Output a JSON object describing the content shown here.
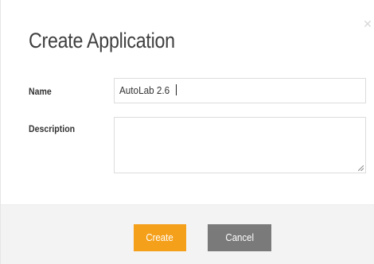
{
  "dialog": {
    "title": "Create Application",
    "close_icon": "close-icon"
  },
  "form": {
    "name_label": "Name",
    "name_value": "AutoLab 2.6",
    "description_label": "Description",
    "description_value": ""
  },
  "footer": {
    "create_label": "Create",
    "cancel_label": "Cancel"
  },
  "colors": {
    "primary_button": "#f5a01a",
    "secondary_button": "#7a7a7a",
    "footer_background": "#f3f3f3"
  }
}
